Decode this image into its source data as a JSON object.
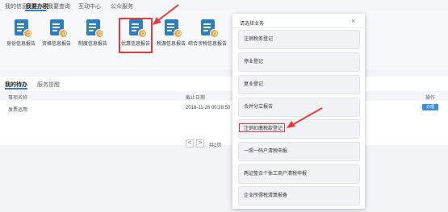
{
  "top_nav": {
    "tabs": [
      "我的信息",
      "我要办税",
      "我要查询",
      "互动中心",
      "公众服务"
    ],
    "active_index": 1
  },
  "services": [
    {
      "label": "身份信息报告"
    },
    {
      "label": "资格信息报告"
    },
    {
      "label": "制度信息报告"
    },
    {
      "label": "优惠信息报告"
    },
    {
      "label": "税源信息报告"
    },
    {
      "label": "综合涉税信息报告"
    }
  ],
  "highlighted_service_index": 3,
  "tasks": {
    "tabs": [
      "我的待办",
      "服务提醒"
    ],
    "active_index": 0,
    "columns": {
      "name": "事项名称",
      "deadline": "截止日期",
      "op": "操作"
    },
    "rows": [
      {
        "name": "发票运用",
        "deadline": "2018-11-26 00:28:50",
        "op_label": "办理"
      }
    ],
    "pager": {
      "prev": "<",
      "next": ">",
      "total": "共1页"
    }
  },
  "modal": {
    "title": "请选择业务",
    "close": "×",
    "options": [
      "注销税务登记",
      "停业登记",
      "复业登记",
      "合并分立报告",
      "注销扣缴税款登记",
      "一照一码户清税申报",
      "两证整合个体工商户清税申报",
      "企业所得税清算报备"
    ],
    "highlighted_option_index": 4
  },
  "colors": {
    "accent": "#2d7fd3",
    "highlight": "#e63b3b",
    "icon": "#2f7fbf",
    "badge": "#f0a33c"
  }
}
